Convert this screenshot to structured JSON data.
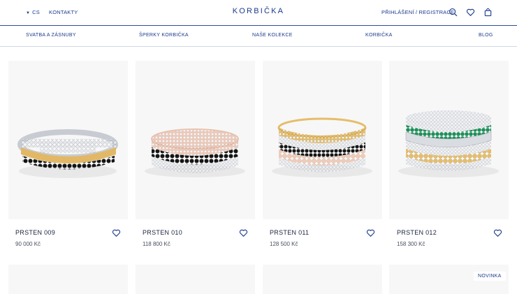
{
  "header": {
    "language": "CS",
    "contacts": "KONTAKTY",
    "brand": "KORBIČKA",
    "login": "PŘIHLÁŠENÍ / REGISTRACE",
    "icons": [
      "search-icon",
      "heart-icon",
      "bag-icon"
    ]
  },
  "nav": {
    "items": [
      {
        "label": "SVATBA A ZÁSNUBY"
      },
      {
        "label": "ŠPERKY KORBIČKA"
      },
      {
        "label": "NAŠE KOLEKCE"
      },
      {
        "label": "KORBIČKA"
      },
      {
        "label": "BLOG"
      }
    ]
  },
  "products": [
    {
      "name": "PRSTEN 009",
      "price": "90 000 Kč"
    },
    {
      "name": "PRSTEN 010",
      "price": "118 800 Kč"
    },
    {
      "name": "PRSTEN 011",
      "price": "128 500 Kč"
    },
    {
      "name": "PRSTEN 012",
      "price": "158 300 Kč"
    }
  ],
  "second_row": {
    "badge": "NOVINKA"
  },
  "colors": {
    "brand_blue": "#1a3a8c",
    "card_bg": "#f7f7f7"
  }
}
